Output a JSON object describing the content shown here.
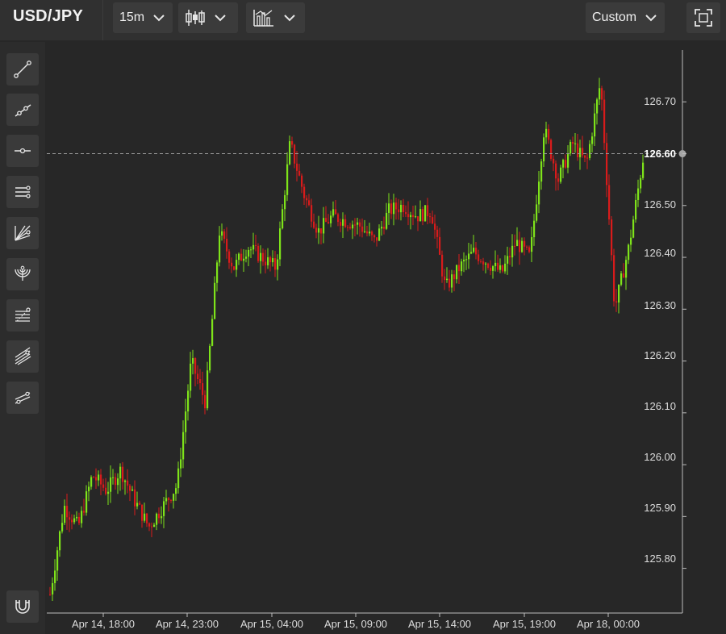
{
  "toolbar": {
    "symbol": "USD/JPY",
    "interval": "15m",
    "chart_type_icon": "candlestick-icon",
    "indicators_icon": "indicators-icon",
    "layout": "Custom",
    "fullscreen_icon": "fullscreen-icon"
  },
  "left_tools": [
    {
      "icon": "trend-line-icon"
    },
    {
      "icon": "ray-line-icon"
    },
    {
      "icon": "horizontal-line-icon"
    },
    {
      "icon": "parallel-channel-icon"
    },
    {
      "icon": "fib-fan-icon"
    },
    {
      "icon": "fib-arcs-icon"
    },
    {
      "icon": "fib-retracement-icon"
    },
    {
      "icon": "pitchfork-icon"
    },
    {
      "icon": "regression-icon"
    },
    {
      "icon": "magnet-icon"
    }
  ],
  "colors": {
    "up": "#7ee31a",
    "down": "#d81b1b",
    "background": "#272727",
    "axis_text": "#dcdcdc"
  },
  "chart_data": {
    "type": "candlestick",
    "y_axis": {
      "ticks": [
        "126.70",
        "126.60",
        "126.50",
        "126.40",
        "126.30",
        "126.20",
        "126.10",
        "126.00",
        "125.90",
        "125.80"
      ],
      "range": [
        125.72,
        126.8
      ]
    },
    "x_axis": {
      "labels": [
        "Apr 14, 18:00",
        "Apr 14, 23:00",
        "Apr 15, 04:00",
        "Apr 15, 09:00",
        "Apr 15, 14:00",
        "Apr 15, 19:00",
        "Apr 18, 00:00"
      ]
    },
    "current_price": "126.60",
    "price_trajectory": [
      125.75,
      125.92,
      125.88,
      125.98,
      125.95,
      125.99,
      125.93,
      125.88,
      125.92,
      125.96,
      126.2,
      126.12,
      126.45,
      126.38,
      126.42,
      126.4,
      126.38,
      126.62,
      126.52,
      126.45,
      126.48,
      126.47,
      126.46,
      126.43,
      126.49,
      126.5,
      126.48,
      126.49,
      126.34,
      126.38,
      126.41,
      126.39,
      126.37,
      126.43,
      126.4,
      126.65,
      126.55,
      126.62,
      126.58,
      126.74,
      126.3,
      126.42,
      126.59
    ]
  }
}
